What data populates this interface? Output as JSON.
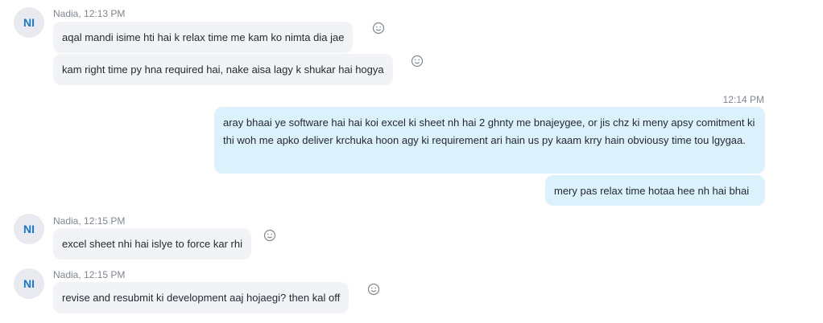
{
  "colors": {
    "incoming_bubble": "#f2f3f6",
    "outgoing_bubble": "#dbf1fb",
    "avatar_bg": "#e8eaf0",
    "avatar_text": "#1a78c9",
    "meta_text": "#7f8793"
  },
  "icons": {
    "reaction": "smiley-icon"
  },
  "chat": {
    "group1": {
      "avatar": "NI",
      "meta": "Nadia, 12:13 PM",
      "messages": [
        "aqal mandi isime hti hai k relax time me kam ko nimta dia jae",
        "kam right time py hna required hai, nake aisa lagy k shukar hai hogya"
      ]
    },
    "group2": {
      "meta": "12:14 PM",
      "messages": [
        "aray bhaai ye software hai hai koi excel ki sheet nh hai 2 ghnty me bnajeygee, or jis chz ki meny apsy comitment ki thi woh me apko deliver krchuka hoon agy ki requirement ari hain us py kaam krry hain obviousy time tou lgygaa.",
        "mery pas relax time hotaa hee nh hai bhai"
      ]
    },
    "group3": {
      "avatar": "NI",
      "meta": "Nadia, 12:15 PM",
      "messages": [
        "excel sheet nhi hai islye to force kar rhi"
      ]
    },
    "group4": {
      "avatar": "NI",
      "meta": "Nadia, 12:15 PM",
      "messages": [
        "revise and resubmit ki development aaj hojaegi? then kal off"
      ]
    }
  }
}
